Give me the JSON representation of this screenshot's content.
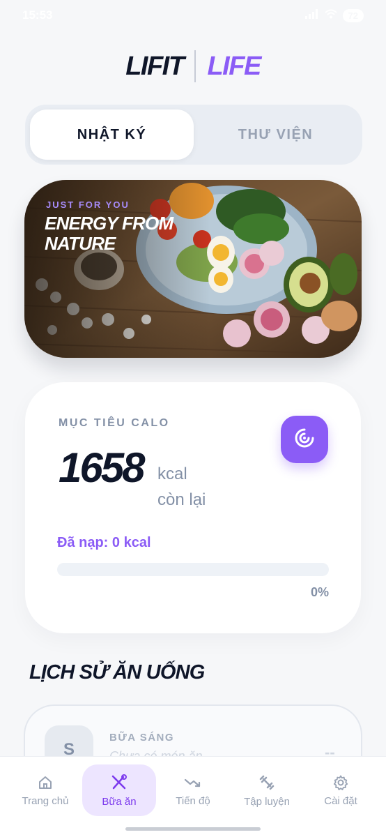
{
  "status_bar": {
    "time": "15:53",
    "battery": "72"
  },
  "brand": {
    "part1": "LIFIT",
    "part2": "LIFE",
    "accent_color": "#8b5cf6",
    "dark_color": "#0f1629"
  },
  "segment": {
    "tabs": [
      {
        "label": "NHẬT KÝ",
        "active": true
      },
      {
        "label": "THƯ VIỆN",
        "active": false
      }
    ]
  },
  "hero": {
    "kicker": "JUST FOR YOU",
    "title": "ENERGY FROM NATURE"
  },
  "calorie": {
    "label": "MỤC TIÊU CALO",
    "value": "1658",
    "unit": "kcal",
    "sub": "còn lại",
    "consumed_text": "Đã nạp: 0 kcal",
    "progress_fraction": 0,
    "progress_text": "0%",
    "button_icon": "target-icon"
  },
  "history": {
    "title": "LỊCH SỬ ĂN UỐNG",
    "meals": [
      {
        "avatar": "S",
        "name": "BỮA SÁNG",
        "hint": "Chưa có món ăn",
        "kcal": "--"
      }
    ]
  },
  "nav": {
    "items": [
      {
        "label": "Trang chủ",
        "icon": "home-icon",
        "active": false
      },
      {
        "label": "Bữa ăn",
        "icon": "utensils-icon",
        "active": true
      },
      {
        "label": "Tiến độ",
        "icon": "trend-icon",
        "active": false
      },
      {
        "label": "Tập luyện",
        "icon": "dumbbell-icon",
        "active": false
      },
      {
        "label": "Cài đặt",
        "icon": "gear-icon",
        "active": false
      }
    ]
  }
}
